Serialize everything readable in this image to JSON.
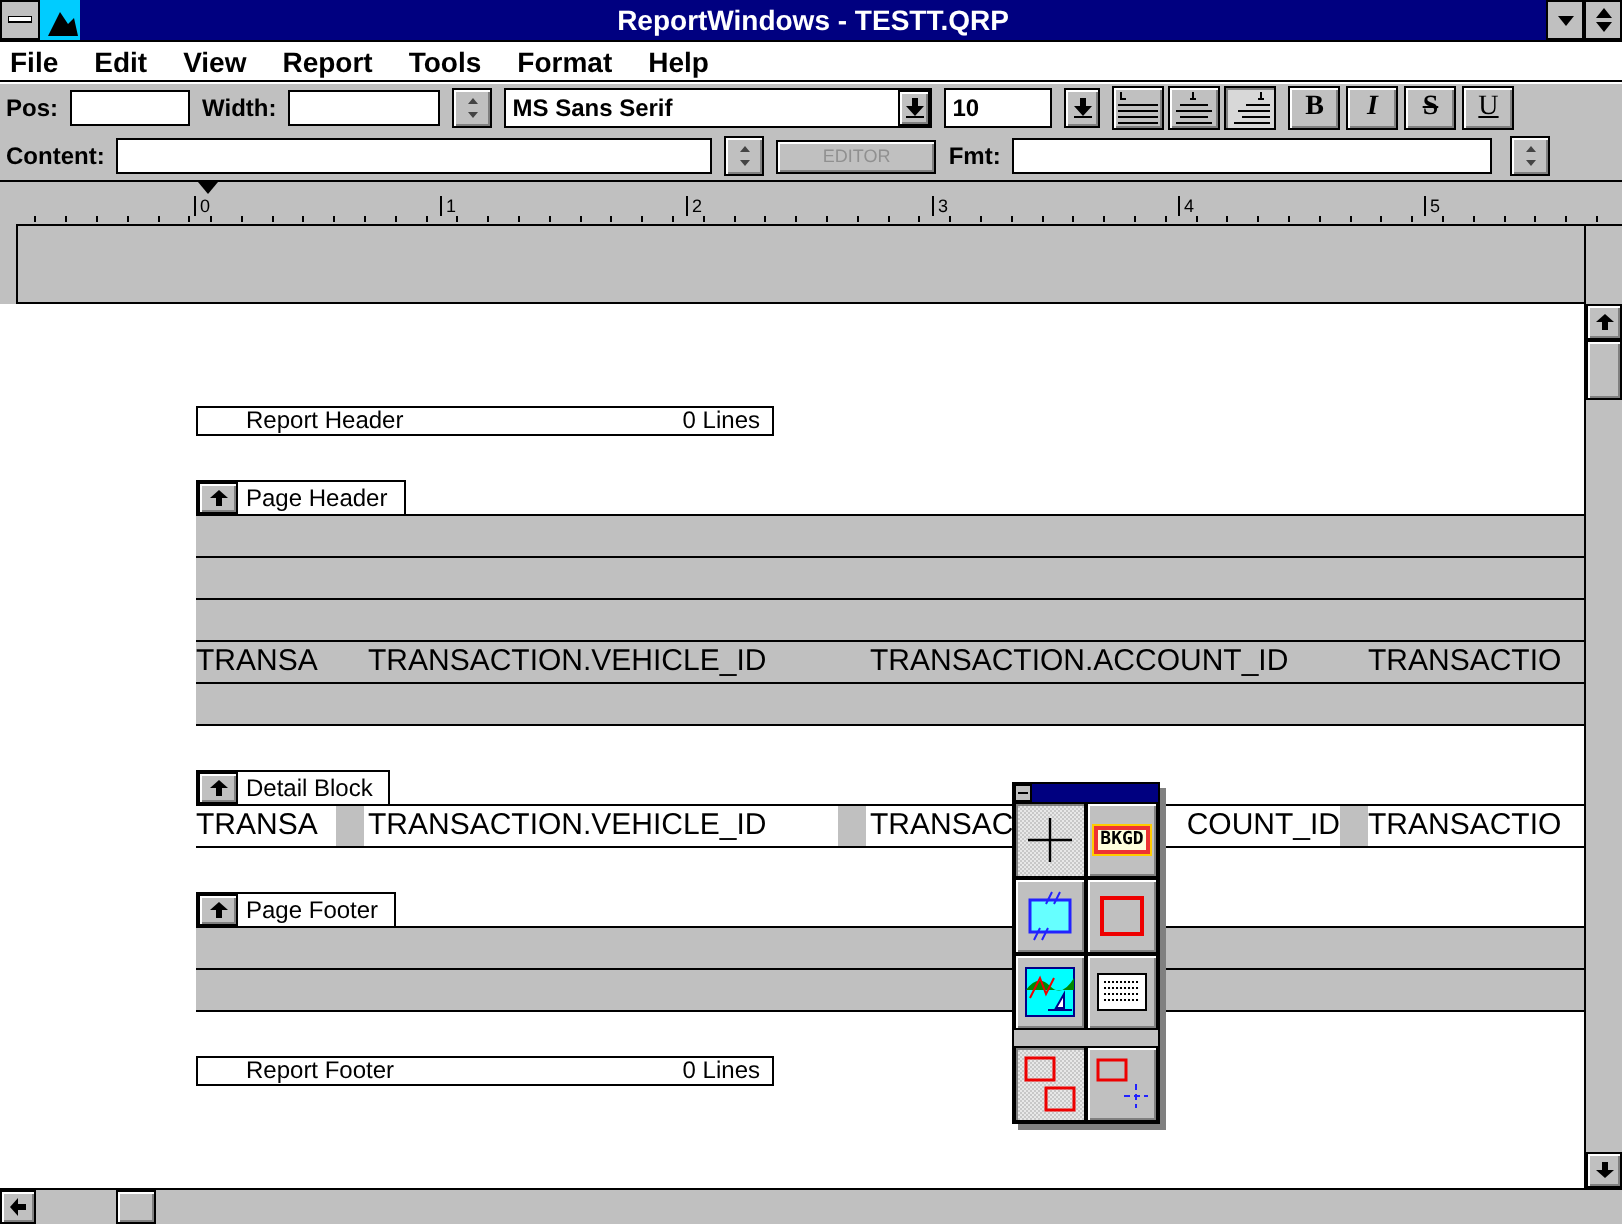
{
  "window": {
    "title": "ReportWindows - TESTT.QRP"
  },
  "menu": [
    {
      "label": "File"
    },
    {
      "label": "Edit"
    },
    {
      "label": "View"
    },
    {
      "label": "Report"
    },
    {
      "label": "Tools"
    },
    {
      "label": "Format"
    },
    {
      "label": "Help"
    }
  ],
  "toolbar": {
    "pos_label": {
      "label": "Pos:"
    },
    "width_label": {
      "label": "Width:"
    },
    "font": "MS Sans Serif",
    "size": "10",
    "align": [
      {
        "kind": "left",
        "selected": false
      },
      {
        "kind": "center",
        "selected": false
      },
      {
        "kind": "right",
        "selected": true
      }
    ],
    "styles": [
      {
        "kind": "bold",
        "label": "B",
        "on": false
      },
      {
        "kind": "italic",
        "label": "I",
        "on": false
      },
      {
        "kind": "strike",
        "label": "S",
        "on": false
      },
      {
        "kind": "underline",
        "label": "U",
        "on": false
      }
    ],
    "content_label": {
      "label": "Content:"
    },
    "editor_button": {
      "label": "EDITOR",
      "disabled": true
    },
    "fmt_label": {
      "label": "Fmt:"
    }
  },
  "ruler": [
    "0",
    "1",
    "2",
    "3",
    "4",
    "5"
  ],
  "sections": [
    {
      "kind": "summary",
      "name": "Report Header",
      "lines": "0 Lines"
    },
    {
      "kind": "band",
      "name": "Page Header",
      "rows": [
        {
          "cells": []
        },
        {
          "cells": []
        },
        {
          "cells": []
        },
        {
          "cells": [
            {
              "parts": [
                "TRANSA"
              ]
            },
            {
              "parts": [
                "TRANSACTION.VEHICLE_ID"
              ]
            },
            {
              "parts": [
                "TRANSACTION.ACCOUNT_ID"
              ]
            },
            {
              "parts": [
                "TRANSACTIO"
              ]
            }
          ]
        },
        {
          "cells": []
        }
      ]
    },
    {
      "kind": "detail",
      "name": "Detail Block",
      "rows": [
        {
          "cells": [
            {
              "parts": [
                "TRANSA"
              ]
            },
            {
              "parts": [
                "TRANSACTION.VEHICLE_ID"
              ]
            },
            {
              "parts": [
                "TRANSAC",
                "COUNT_ID"
              ]
            },
            {
              "parts": [
                "TRANSACTIO"
              ]
            }
          ]
        }
      ]
    },
    {
      "kind": "band",
      "name": "Page Footer",
      "rows": [
        {
          "cells": []
        },
        {
          "cells": []
        }
      ]
    },
    {
      "kind": "summary",
      "name": "Report Footer",
      "lines": "0 Lines"
    }
  ],
  "toolbox": {
    "tools": [
      {
        "kind": "cross",
        "selected": true
      },
      {
        "kind": "background",
        "label": "BKGD",
        "selected": false
      },
      {
        "kind": "link",
        "selected": false
      },
      {
        "kind": "rect",
        "selected": false
      },
      {
        "kind": "picture",
        "selected": false
      },
      {
        "kind": "grid",
        "selected": false
      },
      {
        "kind": "group",
        "selected": true
      },
      {
        "kind": "ungroup",
        "selected": false
      }
    ]
  }
}
